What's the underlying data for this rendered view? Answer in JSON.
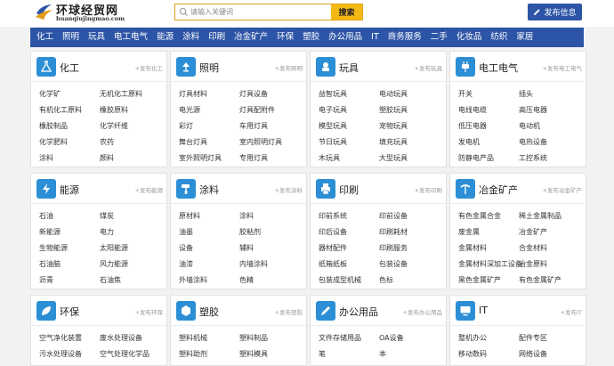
{
  "header": {
    "logo_title": "环球经贸网",
    "logo_sub": "huanqiujingmao.com",
    "search_placeholder": "请输入关键词",
    "search_button": "搜索",
    "publish_button": "发布信息"
  },
  "colors": {
    "brand_blue": "#2d55a7",
    "icon_blue": "#2c8fd6",
    "search_yellow": "#f5b915"
  },
  "nav": [
    "化工",
    "照明",
    "玩具",
    "电工电气",
    "能源",
    "涂料",
    "印刷",
    "冶金矿产",
    "环保",
    "塑胶",
    "办公用品",
    "IT",
    "商务服务",
    "二手",
    "化妆品",
    "纺织",
    "家居"
  ],
  "categories": [
    {
      "title": "化工",
      "publish": "+发布化工",
      "icon": "flask-icon",
      "links": [
        "化学矿",
        "无机化工原料",
        "有机化工原料",
        "橡胶原料",
        "橡胶制品",
        "化学纤维",
        "化学肥料",
        "农药",
        "涂料",
        "颜料"
      ]
    },
    {
      "title": "照明",
      "publish": "+发布照明",
      "icon": "lamp-icon",
      "links": [
        "灯具材料",
        "灯具设备",
        "电光源",
        "灯具配附件",
        "彩灯",
        "车用灯具",
        "舞台灯具",
        "室内照明灯具",
        "室外照明灯具",
        "专用灯具"
      ]
    },
    {
      "title": "玩具",
      "publish": "+发布玩具",
      "icon": "toy-icon",
      "links": [
        "益智玩具",
        "电动玩具",
        "电子玩具",
        "塑胶玩具",
        "模型玩具",
        "宠物玩具",
        "节日玩具",
        "填充玩具",
        "木玩具",
        "大型玩具"
      ]
    },
    {
      "title": "电工电气",
      "publish": "+发布电工电气",
      "icon": "plug-icon",
      "links": [
        "开关",
        "插头",
        "电线电缆",
        "高压电器",
        "低压电器",
        "电动机",
        "发电机",
        "电热设备",
        "防静电产品",
        "工控系统"
      ]
    },
    {
      "title": "能源",
      "publish": "+发布能源",
      "icon": "energy-icon",
      "links": [
        "石油",
        "煤炭",
        "新能源",
        "电力",
        "生物能源",
        "太阳能源",
        "石油脑",
        "风力能源",
        "沥青",
        "石油焦"
      ]
    },
    {
      "title": "涂料",
      "publish": "+发布涂料",
      "icon": "paint-icon",
      "links": [
        "原材料",
        "涂料",
        "油墨",
        "胶粘剂",
        "设备",
        "辅料",
        "油漆",
        "内墙涂料",
        "外墙涂料",
        "色精"
      ]
    },
    {
      "title": "印刷",
      "publish": "+发布印刷",
      "icon": "printer-icon",
      "links": [
        "印前系统",
        "印前设备",
        "印后设备",
        "印刷耗材",
        "器材配件",
        "印刷服务",
        "纸箱纸板",
        "包装设备",
        "包装成型机械",
        "色标"
      ]
    },
    {
      "title": "冶金矿产",
      "publish": "+发布冶金矿产",
      "icon": "mining-icon",
      "links": [
        "有色金属合金",
        "稀土金属制品",
        "废金属",
        "冶金矿产",
        "金属材料",
        "合金材料",
        "金属材料深加工设备",
        "冶金原料",
        "黑色金属矿产",
        "有色金属矿产"
      ]
    },
    {
      "title": "环保",
      "publish": "+发布环保",
      "icon": "leaf-icon",
      "links": [
        "空气净化装置",
        "废水处理设备",
        "污水处理设备",
        "空气处理化学品"
      ]
    },
    {
      "title": "塑胶",
      "publish": "+发布塑胶",
      "icon": "cube-icon",
      "links": [
        "塑料机械",
        "塑料制品",
        "塑料助剂",
        "塑料模具"
      ]
    },
    {
      "title": "办公用品",
      "publish": "+发布办公用品",
      "icon": "pen-icon",
      "links": [
        "文件存储用品",
        "OA设备",
        "笔",
        "本"
      ]
    },
    {
      "title": "IT",
      "publish": "+发布IT",
      "icon": "monitor-icon",
      "links": [
        "整机办公",
        "配件专区",
        "移动数码",
        "网络设备"
      ]
    }
  ]
}
